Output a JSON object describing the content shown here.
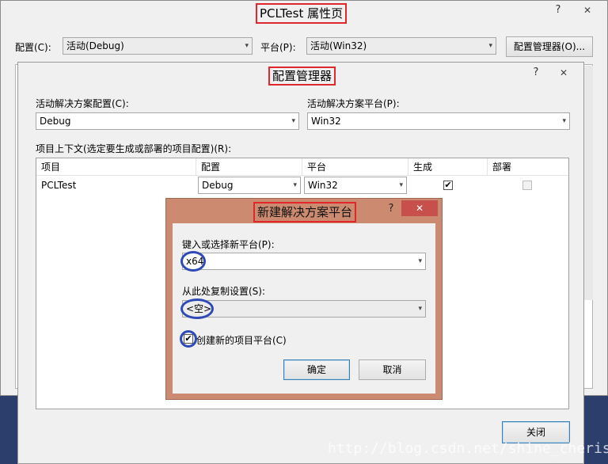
{
  "property_window": {
    "title": "PCLTest 属性页",
    "help": "?",
    "close": "✕",
    "config_label": "配置(C):",
    "config_value": "活动(Debug)",
    "platform_label": "平台(P):",
    "platform_value": "活动(Win32)",
    "config_manager_button": "配置管理器(O)..."
  },
  "config_manager": {
    "title": "配置管理器",
    "help": "?",
    "close": "✕",
    "active_config_label": "活动解决方案配置(C):",
    "active_config_value": "Debug",
    "active_platform_label": "活动解决方案平台(P):",
    "active_platform_value": "Win32",
    "contexts_label": "项目上下文(选定要生成或部署的项目配置)(R):",
    "columns": [
      "项目",
      "配置",
      "平台",
      "生成",
      "部署"
    ],
    "rows": [
      {
        "project": "PCLTest",
        "config": "Debug",
        "platform": "Win32",
        "build": "✔",
        "deploy": ""
      }
    ],
    "close_button": "关闭"
  },
  "new_platform_dialog": {
    "title": "新建解决方案平台",
    "help": "?",
    "close": "✕",
    "new_platform_label": "键入或选择新平台(P):",
    "new_platform_value": "x64",
    "copy_from_label": "从此处复制设置(S):",
    "copy_from_value": "<空>",
    "create_project_platforms_label": "创建新的项目平台(C)",
    "create_project_platforms_check": "✔",
    "ok_button": "确定",
    "cancel_button": "取消"
  },
  "watermark": "http://blog.csdn.net/shine_cherise",
  "icons": {
    "dropdown": "▾"
  },
  "colors": {
    "annotation_red": "#e0282c",
    "annotation_blue": "#2f4ab5",
    "dialog_frame": "#cc8a70",
    "close_red": "#c7504c"
  }
}
